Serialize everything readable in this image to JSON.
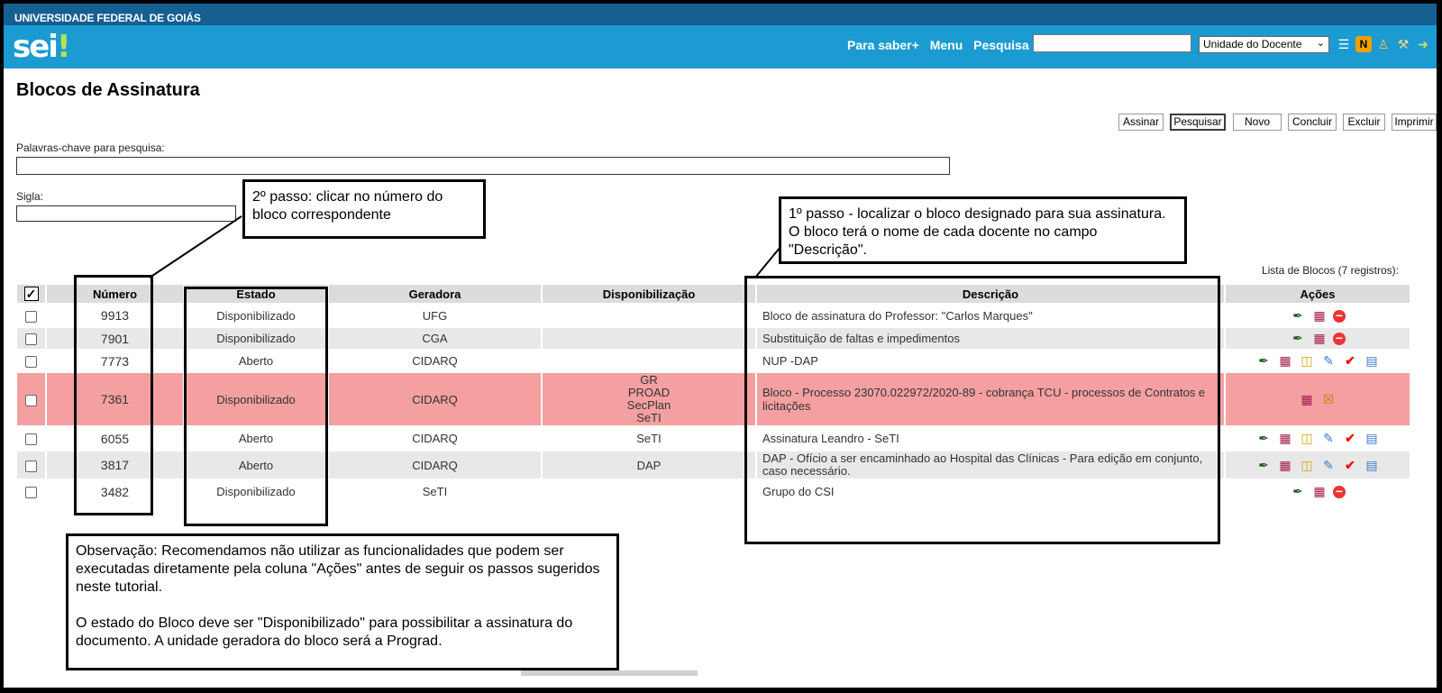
{
  "header": {
    "institution": "UNIVERSIDADE FEDERAL DE GOIÁS",
    "logo": "sei",
    "logo_mark": "!",
    "nav": [
      "Para saber+",
      "Menu",
      "Pesquisa"
    ],
    "search_value": "",
    "unit_selected": "Unidade do Docente",
    "icons": [
      "list-icon",
      "notes-icon",
      "user-icon",
      "wrench-icon",
      "exit-icon"
    ]
  },
  "page": {
    "title": "Blocos de Assinatura",
    "buttons": [
      {
        "label": "Assinar",
        "key": "A"
      },
      {
        "label": "Pesquisar",
        "key": "P"
      },
      {
        "label": "Novo",
        "key": "N"
      },
      {
        "label": "Concluir",
        "key": "C"
      },
      {
        "label": "Excluir",
        "key": "E"
      },
      {
        "label": "Imprimir",
        "key": "I"
      }
    ],
    "keywords_label": "Palavras-chave para pesquisa:",
    "keywords_value": "",
    "sigla_label": "Sigla:",
    "sigla_value": ""
  },
  "table": {
    "caption": "Lista de Blocos (7 registros):",
    "headers": [
      "",
      "Número",
      "Estado",
      "Geradora",
      "Disponibilização",
      "Descrição",
      "Ações"
    ],
    "rows": [
      {
        "numero": "9913",
        "num_color": "red",
        "estado": "Disponibilizado",
        "geradora": "UFG",
        "disp": [],
        "desc": "Bloco de assinatura do Professor: \"Carlos Marques\"",
        "acoes": [
          "pen",
          "doc",
          "stop"
        ]
      },
      {
        "numero": "7901",
        "num_color": "red",
        "estado": "Disponibilizado",
        "geradora": "CGA",
        "disp": [],
        "desc": "Substituição de faltas e impedimentos",
        "acoes": [
          "pen",
          "doc",
          "stop"
        ]
      },
      {
        "numero": "7773",
        "num_color": "green",
        "estado": "Aberto",
        "geradora": "CIDARQ",
        "disp": [],
        "desc": "NUP -DAP",
        "acoes": [
          "pen",
          "doc",
          "folder",
          "edit",
          "check",
          "cal"
        ]
      },
      {
        "numero": "7361",
        "num_color": "red",
        "estado": "Disponibilizado",
        "geradora": "CIDARQ",
        "disp": [
          "GR",
          "PROAD",
          "SecPlan",
          "SeTI"
        ],
        "desc": "Bloco - Processo 23070.022972/2020-89 - cobrança TCU - processos de Contratos e licitações",
        "acoes": [
          "doc",
          "x"
        ],
        "highlight": true
      },
      {
        "numero": "6055",
        "num_color": "green",
        "estado": "Aberto",
        "geradora": "CIDARQ",
        "disp": [
          "SeTI"
        ],
        "desc": "Assinatura Leandro - SeTI",
        "acoes": [
          "pen",
          "doc",
          "folder",
          "edit",
          "check",
          "cal"
        ]
      },
      {
        "numero": "3817",
        "num_color": "green",
        "estado": "Aberto",
        "geradora": "CIDARQ",
        "disp": [
          "DAP"
        ],
        "desc": "DAP - Ofício a ser encaminhado ao Hospital das Clínicas - Para edição em conjunto, caso necessário.",
        "acoes": [
          "pen",
          "doc",
          "folder",
          "edit",
          "check",
          "cal"
        ]
      },
      {
        "numero": "3482",
        "num_color": "red",
        "estado": "Disponibilizado",
        "geradora": "SeTI",
        "disp": [],
        "desc": "Grupo do CSI",
        "acoes": [
          "pen",
          "doc",
          "stop"
        ]
      }
    ]
  },
  "notes": {
    "step2": "2º passo: clicar no número do bloco correspondente",
    "step1": "1º passo - localizar o bloco designado para sua assinatura. O bloco terá o nome de cada docente no campo \"Descrição\".",
    "obs1": "Observação: Recomendamos não utilizar as funcionalidades que podem ser executadas diretamente pela coluna \"Ações\" antes de seguir os passos sugeridos neste tutorial.",
    "obs2": "O estado do Bloco deve ser \"Disponibilizado\" para possibilitar a assinatura do documento. A unidade geradora do bloco será a Prograd."
  },
  "colors": {
    "header_dark": "#155f91",
    "header_light": "#1b9bd2",
    "row_highlight": "#f4a0a0",
    "num_red": "#e21b1b",
    "num_green": "#2f7d2f"
  }
}
